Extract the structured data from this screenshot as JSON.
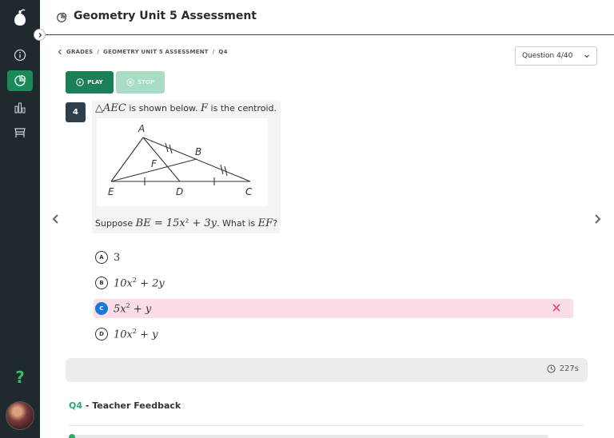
{
  "header": {
    "title": "Geometry Unit 5 Assessment"
  },
  "breadcrumb": {
    "items": [
      "GRADES",
      "GEOMETRY UNIT 5 ASSESSMENT",
      "Q4"
    ]
  },
  "question_select": {
    "value": "Question 4/40"
  },
  "controls": {
    "play_label": "PLAY",
    "stop_label": "STOP"
  },
  "question": {
    "number": "4",
    "intro_triangle": "△AEC",
    "intro_mid": " is shown below. ",
    "intro_F": "F",
    "intro_end": " is the centroid.",
    "diagram_labels": {
      "A": "A",
      "B": "B",
      "C": "C",
      "D": "D",
      "E": "E",
      "F": "F"
    },
    "prompt_suppose": "Suppose ",
    "prompt_be": "BE = 15x",
    "prompt_exp": "2",
    "prompt_rest": " + 3y",
    "prompt_what": ". What is ",
    "prompt_ef": "EF",
    "prompt_q": "?"
  },
  "choices": [
    {
      "letter": "A",
      "base": "3",
      "exp": "",
      "rest": ""
    },
    {
      "letter": "B",
      "base": "10x",
      "exp": "2",
      "rest": " + 2y"
    },
    {
      "letter": "C",
      "base": "5x",
      "exp": "2",
      "rest": " + y"
    },
    {
      "letter": "D",
      "base": "10x",
      "exp": "2",
      "rest": " + y"
    }
  ],
  "selected_choice": "C",
  "timer": {
    "value": "227s"
  },
  "feedback": {
    "qnum": "Q4",
    "title": " - Teacher Feedback"
  },
  "colors": {
    "sidebar": "#1f2a2e",
    "accent": "#1b8a5a",
    "selected_bg": "#fbdde6",
    "selected_bubble": "#1679d8",
    "wrong": "#e0457b"
  }
}
